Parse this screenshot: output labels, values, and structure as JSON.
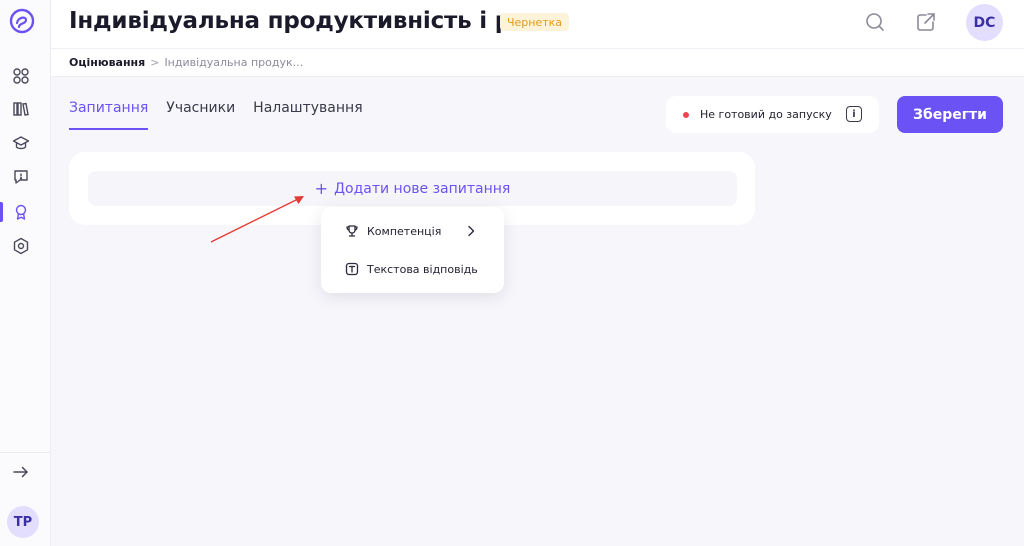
{
  "header": {
    "title": "Індивідуальна продуктивність і р...",
    "status": "Чернетка",
    "user_initials": "DC"
  },
  "breadcrumb": {
    "root": "Оцінювання",
    "separator": ">",
    "current": "Індивідуальна продук..."
  },
  "tabs": [
    {
      "label": "Запитання",
      "active": true
    },
    {
      "label": "Учасники",
      "active": false
    },
    {
      "label": "Налаштування",
      "active": false
    }
  ],
  "launch_status": {
    "text": "Не готовий до запуску",
    "info_glyph": "i"
  },
  "actions": {
    "save_label": "Зберегти"
  },
  "add_question": {
    "plus": "+",
    "label": "Додати нове запитання"
  },
  "dropdown": {
    "items": [
      {
        "label": "Компетенція",
        "icon": "trophy-icon",
        "has_submenu": true
      },
      {
        "label": "Текстова відповідь",
        "icon": "text-box-icon",
        "has_submenu": false
      }
    ]
  },
  "sidebar": {
    "icons": [
      "dashboard-icon",
      "library-icon",
      "graduation-cap-icon",
      "feedback-icon",
      "award-icon",
      "settings-icon"
    ],
    "active": "award-icon",
    "collapse_icon": "arrow-right-icon",
    "user_initials": "TP"
  },
  "colors": {
    "accent": "#6b52f5",
    "draft_badge_bg": "#fdf3d8",
    "draft_badge_text": "#e29b1d",
    "status_dot": "#ef4450",
    "annotation_arrow": "#e53935"
  }
}
